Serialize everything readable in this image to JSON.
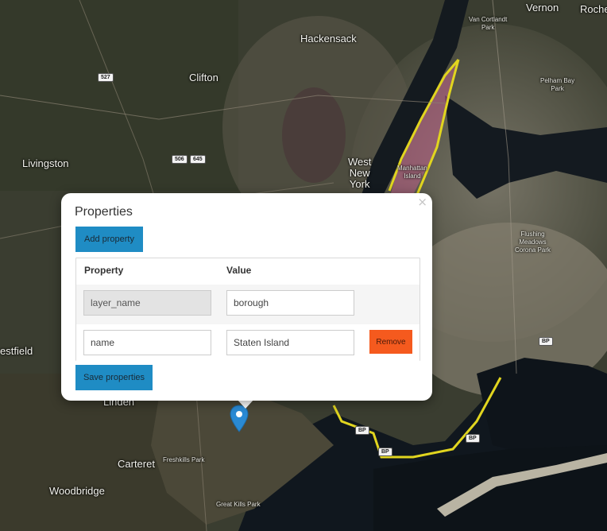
{
  "map": {
    "place_labels": [
      {
        "key": "vernon",
        "text": "Vernon"
      },
      {
        "key": "roche",
        "text": "Roche"
      },
      {
        "key": "vancortlandt",
        "text": "Van Cortlandt\nPark"
      },
      {
        "key": "hackensack",
        "text": "Hackensack"
      },
      {
        "key": "clifton",
        "text": "Clifton"
      },
      {
        "key": "pelhambay",
        "text": "Pelham Bay\nPark"
      },
      {
        "key": "livingston",
        "text": "Livingston"
      },
      {
        "key": "westnewyork",
        "text": "West\nNew\nYork"
      },
      {
        "key": "manhattan",
        "text": "Manhattan\nIsland"
      },
      {
        "key": "flushing",
        "text": "Flushing\nMeadows\nCorona Park"
      },
      {
        "key": "westfield",
        "text": "estfield"
      },
      {
        "key": "linden",
        "text": "Linden"
      },
      {
        "key": "carteret",
        "text": "Carteret"
      },
      {
        "key": "freshkills",
        "text": "Freshkills Park"
      },
      {
        "key": "woodbridge",
        "text": "Woodbridge"
      },
      {
        "key": "greatkills",
        "text": "Great Kills Park"
      }
    ],
    "shields": [
      {
        "key": "r527",
        "text": "527"
      },
      {
        "key": "r506",
        "text": "506"
      },
      {
        "key": "r645",
        "text": "645"
      },
      {
        "key": "bp1",
        "text": "BP"
      },
      {
        "key": "bp2",
        "text": "BP"
      },
      {
        "key": "bp3",
        "text": "BP"
      },
      {
        "key": "bp4",
        "text": "BP"
      }
    ],
    "colors": {
      "boundary": "#e1d51f",
      "highlight_fill": "#c0608a",
      "water": "#10171e",
      "land": "#3a3d30"
    }
  },
  "marker": {
    "icon": "map-pin-icon",
    "color": "#2a8ad4"
  },
  "popup": {
    "title": "Properties",
    "close_glyph": "×",
    "add_button": "Add property",
    "save_button": "Save properties",
    "table": {
      "headers": {
        "property": "Property",
        "value": "Value"
      },
      "rows": [
        {
          "key": "layer_name",
          "value": "borough",
          "key_readonly": true,
          "has_remove": false
        },
        {
          "key": "name",
          "value": "Staten Island",
          "key_readonly": false,
          "has_remove": true,
          "remove_label": "Remove"
        }
      ]
    },
    "colors": {
      "primary": "#1f8cc4",
      "danger": "#f55a1e"
    }
  }
}
